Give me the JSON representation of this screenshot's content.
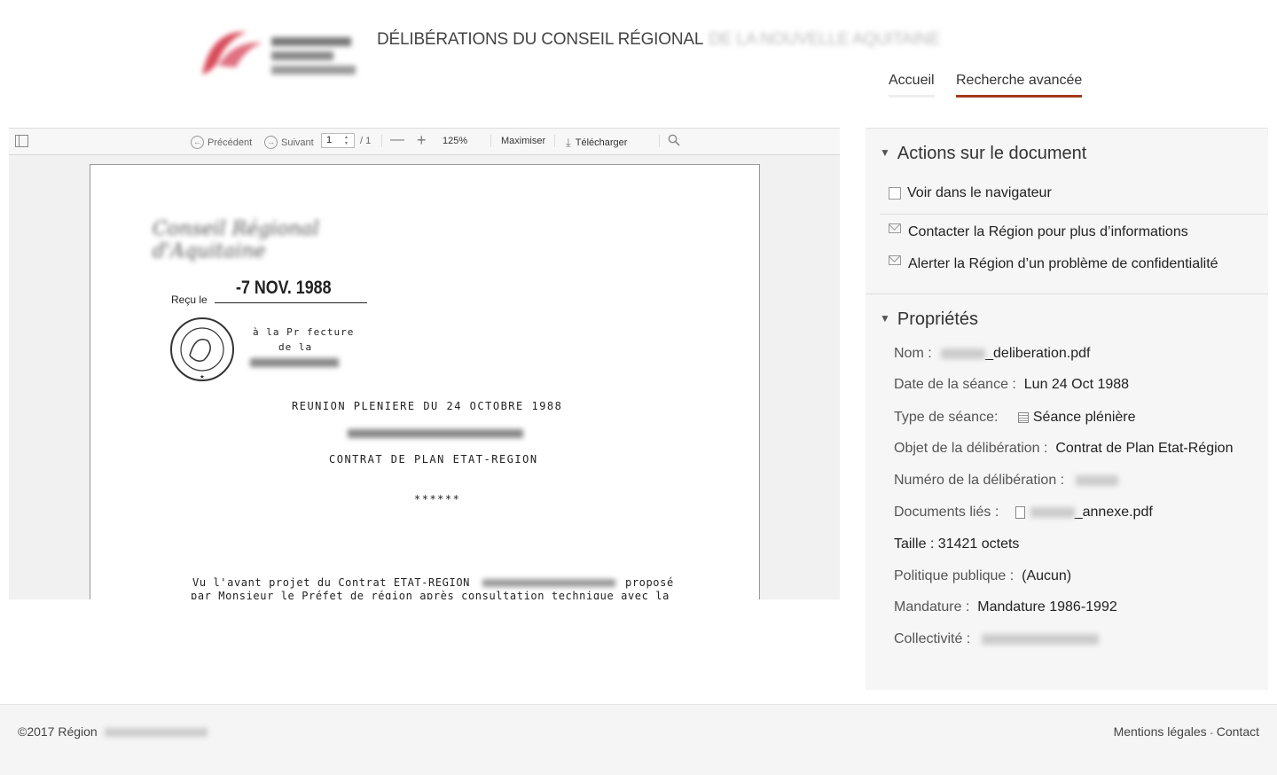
{
  "header": {
    "title": "DÉLIBÉRATIONS DU CONSEIL RÉGIONAL",
    "title_redacted": "DE LA NOUVELLE AQUITAINE",
    "logo_text": "Nouvelle-Aquitaine"
  },
  "nav": [
    {
      "label": "Accueil"
    },
    {
      "label": "Recherche avancée"
    }
  ],
  "toolbar": {
    "previous": "Précédent",
    "next": "Suivant",
    "page_value": "1",
    "page_total": "/ 1",
    "zoom": "125%",
    "maximize": "Maximiser",
    "download": "Télécharger"
  },
  "document": {
    "received_label": "Reçu le",
    "received_date": "-7 NOV. 1988",
    "prefecture_line1": "à la Pr fecture",
    "prefecture_line2": "de la",
    "meeting": "REUNION PLENIERE  DU 24 OCTOBRE 1988",
    "subject": "CONTRAT DE PLAN ETAT-REGION",
    "stars": "******",
    "body_line1": "Vu l'avant projet du Contrat ETAT-REGION",
    "body_line1_end": "proposé",
    "body_line2": "par Monsieur le Préfet de région après consultation technique avec la"
  },
  "actions_section": {
    "title": "Actions sur le document",
    "items": [
      {
        "label": "Voir dans le navigateur",
        "icon": "browser-doc-icon"
      },
      {
        "label": "Contacter la Région pour plus d’informations",
        "icon": "mail-icon"
      },
      {
        "label": "Alerter la Région d’un problème de confidentialité",
        "icon": "mail-icon"
      }
    ]
  },
  "properties_section": {
    "title": "Propriétés",
    "nom_label": "Nom :",
    "nom_value": "_deliberation.pdf",
    "date_label": "Date de la séance :",
    "date_value": "Lun 24 Oct 1988",
    "type_label": "Type de séance:",
    "type_value": "Séance plénière",
    "objet_label": "Objet de la délibération :",
    "objet_value": "Contrat de Plan Etat-Région",
    "numero_label": "Numéro de la délibération :",
    "docs_label": "Documents liés :",
    "docs_value": "_annexe.pdf",
    "taille_label": "Taille : 31421 octets",
    "politique_label": "Politique publique :",
    "politique_value": "(Aucun)",
    "mandature_label": "Mandature :",
    "mandature_value": "Mandature 1986-1992",
    "collectivite_label": "Collectivité :"
  },
  "footer": {
    "copyright": "©2017 Région",
    "mentions": "Mentions légales",
    "separator": "-",
    "contact": "Contact"
  },
  "colors": {
    "accent": "#a33a1b"
  }
}
